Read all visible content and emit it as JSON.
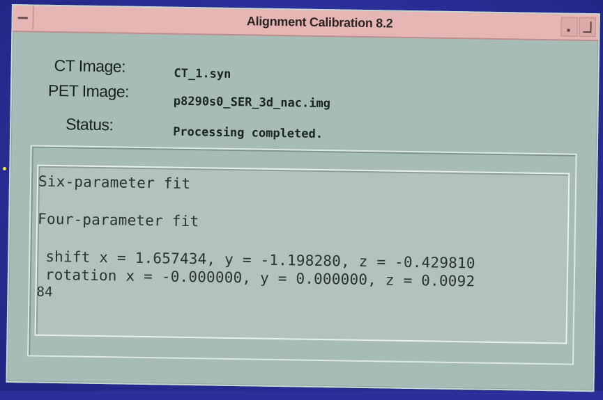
{
  "window": {
    "title": "Alignment Calibration 8.2"
  },
  "fields": {
    "ct_label": "CT Image:",
    "ct_value": "CT_1.syn",
    "pet_label": "PET Image:",
    "pet_value": "p8290s0_SER_3d_nac.img",
    "status_label": "Status:",
    "status_value": "Processing completed."
  },
  "output": {
    "lines": [
      "Six-parameter fit",
      "Four-parameter fit",
      "shift x = 1.657434, y = -1.198280, z = -0.429810",
      "rotation x = -0.000000, y = 0.000000, z = 0.0092",
      "84"
    ]
  },
  "colors": {
    "background": "#2a2f9a",
    "window": "#a8bcb7",
    "titlebar": "#e6b6b4",
    "bullet": "#f2e64a"
  }
}
